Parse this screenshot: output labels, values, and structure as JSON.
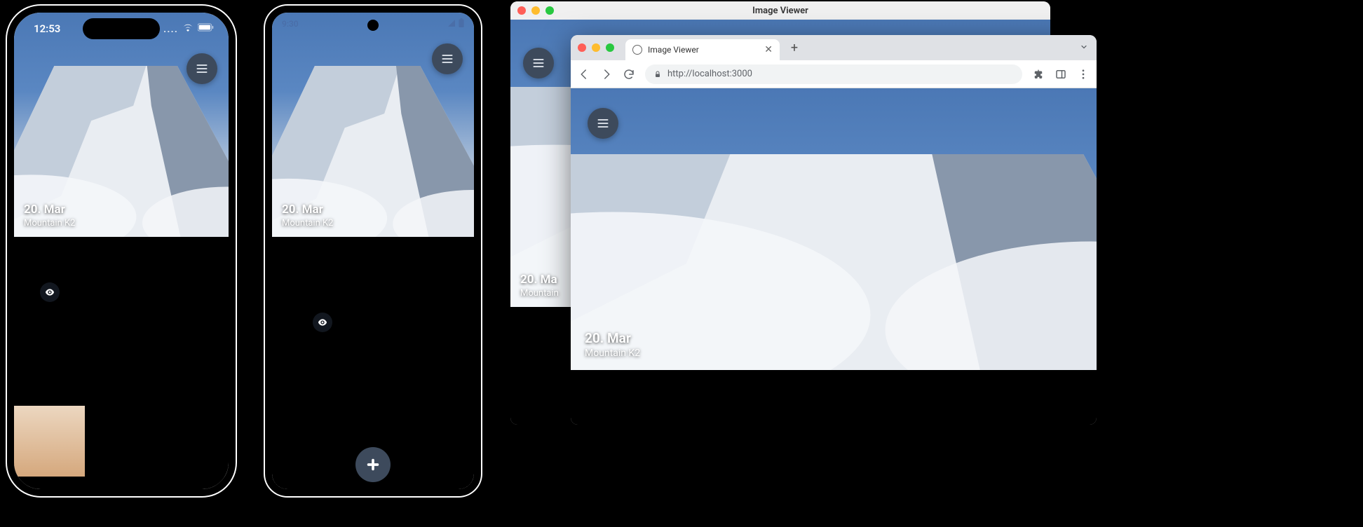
{
  "iphone": {
    "status_time": "12:53",
    "hero": {
      "date": "20. Mar",
      "title": "Mountain K2"
    }
  },
  "android": {
    "status_time": "9:30",
    "hero": {
      "date": "20. Mar",
      "title": "Mountain K2"
    }
  },
  "mac": {
    "window_title": "Image Viewer",
    "hero": {
      "date": "20. Ma",
      "title": "Mountain"
    }
  },
  "browser": {
    "tab_title": "Image Viewer",
    "url": "http://localhost:3000",
    "hero": {
      "date": "20. Mar",
      "title": "Mountain K2"
    }
  },
  "icons": {
    "menu": "hamburger-menu",
    "eye": "preview-eye",
    "fab_plus": "plus",
    "back": "back",
    "forward": "forward",
    "reload": "reload",
    "lock": "lock",
    "ext": "extensions",
    "side": "side-panel",
    "kebab": "more"
  },
  "colors": {
    "menu_btn": "#3d4a5c",
    "sky_top": "#4b78b5",
    "sky_bottom": "#e9eef3"
  }
}
